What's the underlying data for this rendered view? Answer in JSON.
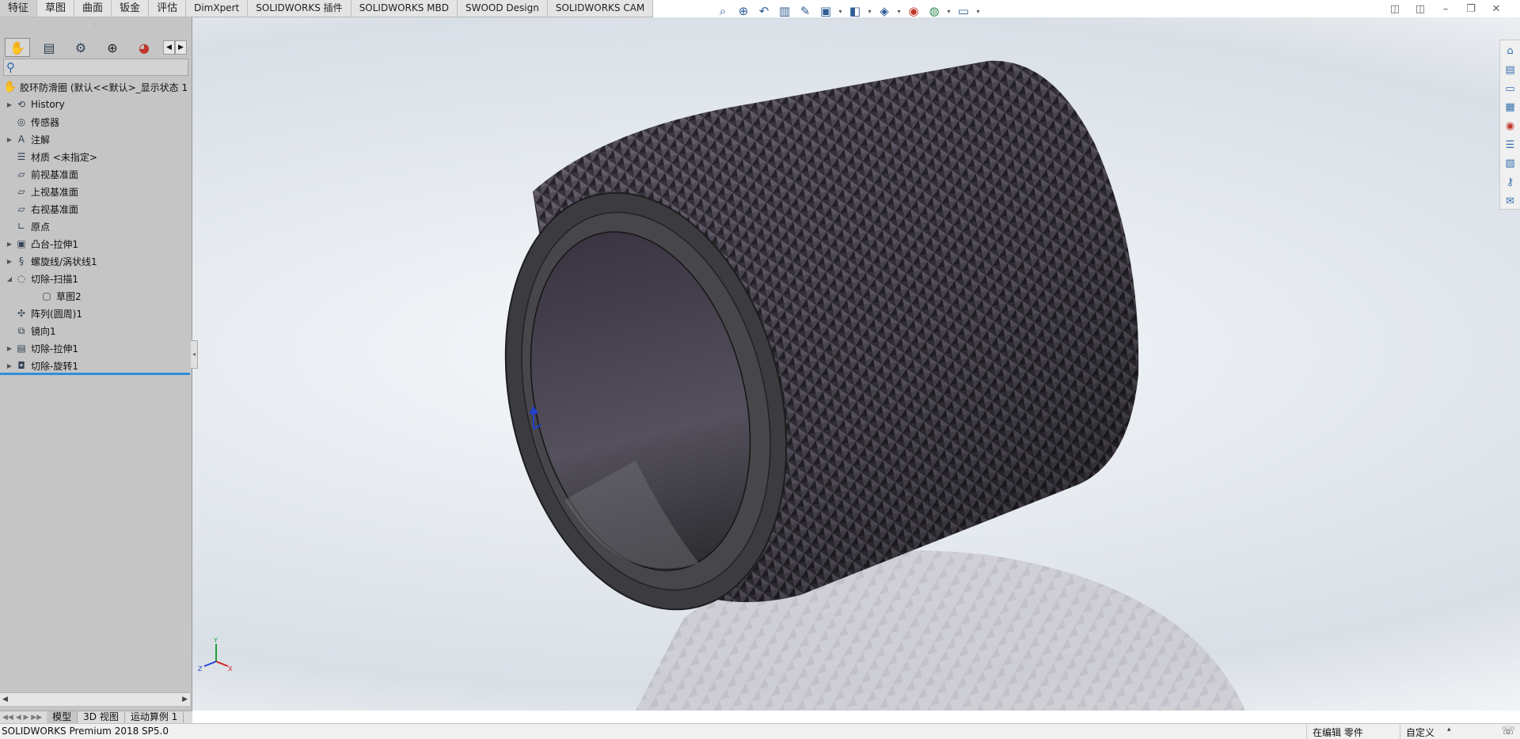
{
  "command_tabs": [
    {
      "label": "特征",
      "active": true
    },
    {
      "label": "草图"
    },
    {
      "label": "曲面"
    },
    {
      "label": "钣金"
    },
    {
      "label": "评估"
    },
    {
      "label": "DimXpert"
    },
    {
      "label": "SOLIDWORKS 插件"
    },
    {
      "label": "SOLIDWORKS MBD"
    },
    {
      "label": "SWOOD Design"
    },
    {
      "label": "SOLIDWORKS CAM"
    }
  ],
  "hud_icons": [
    "zoom-to-fit-icon",
    "zoom-area-icon",
    "previous-view-icon",
    "section-view-icon",
    "dynamic-annotation-icon",
    "view-orientation-icon",
    "display-style-icon",
    "hide-show-icon",
    "edit-appearance-icon",
    "apply-scene-icon",
    "view-settings-icon"
  ],
  "feature_tree": {
    "root": "胶环防滑圈 (默认<<默认>_显示状态 1",
    "items": [
      {
        "label": "History",
        "expandable": true,
        "icon": "history-icon"
      },
      {
        "label": "传感器",
        "expandable": false,
        "icon": "sensor-icon"
      },
      {
        "label": "注解",
        "expandable": true,
        "icon": "annotation-icon"
      },
      {
        "label": "材质 <未指定>",
        "expandable": false,
        "icon": "material-icon"
      },
      {
        "label": "前视基准面",
        "expandable": false,
        "icon": "plane-icon"
      },
      {
        "label": "上视基准面",
        "expandable": false,
        "icon": "plane-icon"
      },
      {
        "label": "右视基准面",
        "expandable": false,
        "icon": "plane-icon"
      },
      {
        "label": "原点",
        "expandable": false,
        "icon": "origin-icon"
      },
      {
        "label": "凸台-拉伸1",
        "expandable": true,
        "icon": "extrude-boss-icon"
      },
      {
        "label": "螺旋线/涡状线1",
        "expandable": true,
        "icon": "helix-icon"
      },
      {
        "label": "切除-扫描1",
        "expandable": true,
        "expanded": true,
        "icon": "cut-sweep-icon"
      },
      {
        "label": "草图2",
        "expandable": false,
        "child": true,
        "icon": "sketch-icon"
      },
      {
        "label": "阵列(圆周)1",
        "expandable": false,
        "icon": "circular-pattern-icon"
      },
      {
        "label": "镜向1",
        "expandable": false,
        "icon": "mirror-icon"
      },
      {
        "label": "切除-拉伸1",
        "expandable": true,
        "icon": "cut-extrude-icon"
      },
      {
        "label": "切除-旋转1",
        "expandable": true,
        "icon": "cut-revolve-icon"
      }
    ]
  },
  "bottom_tabs": [
    {
      "label": "模型",
      "active": true
    },
    {
      "label": "3D 视图"
    },
    {
      "label": "运动算例 1"
    }
  ],
  "status": {
    "product": "SOLIDWORKS Premium 2018 SP5.0",
    "state": "在编辑 零件",
    "units": "自定义"
  },
  "triad": {
    "x": "X",
    "y": "Y",
    "z": "Z"
  },
  "colors": {
    "accent": "#2f8ed5",
    "panel": "#c5c5c5",
    "model": "#3a3a3e",
    "knurl": "#4a4350"
  }
}
